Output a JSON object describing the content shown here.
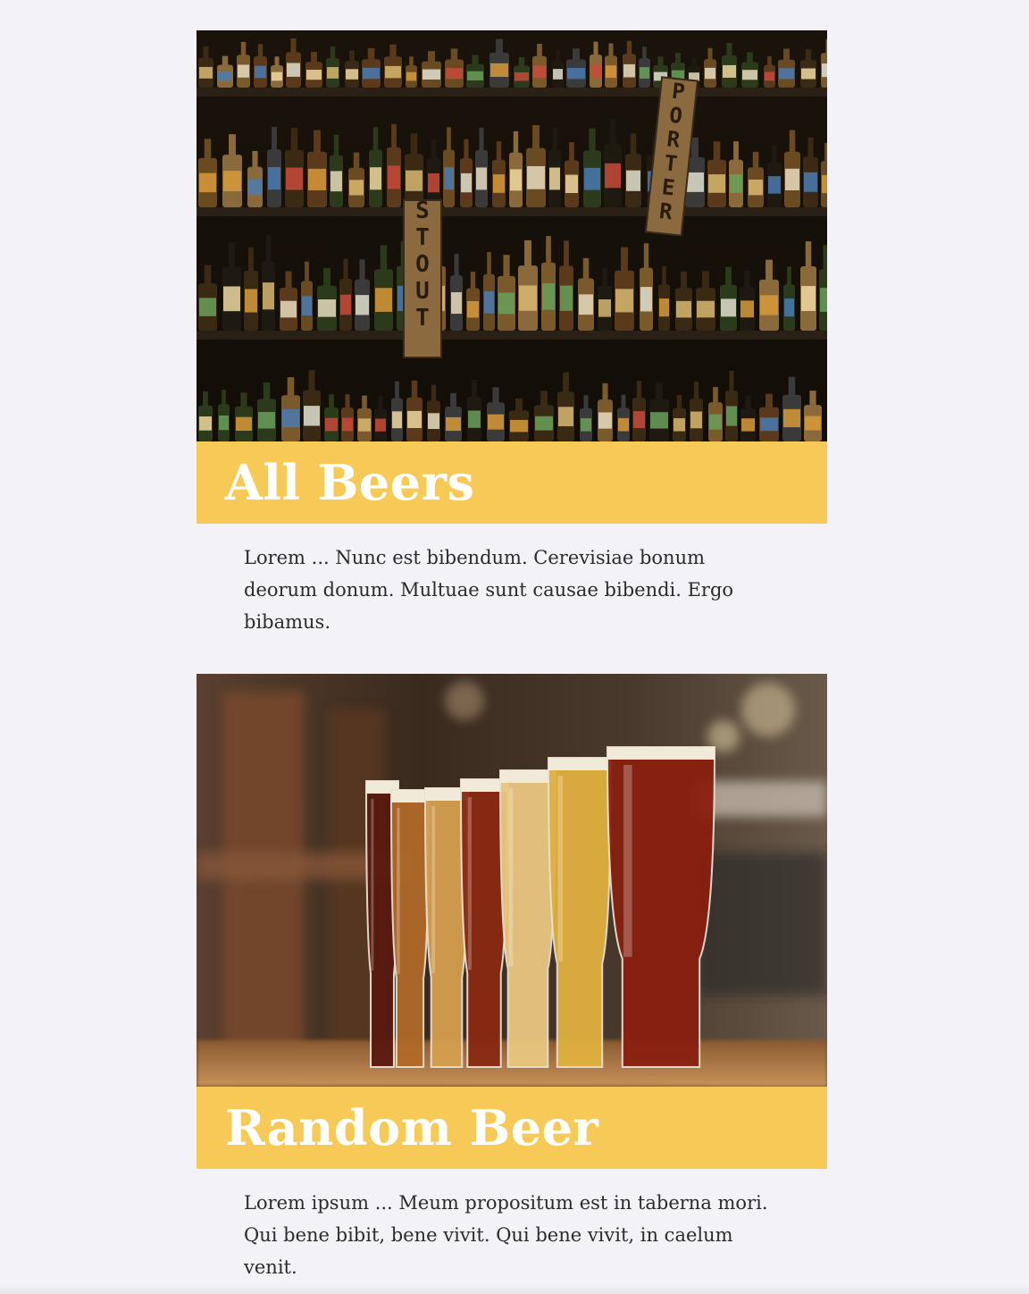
{
  "cards": [
    {
      "title": "All Beers",
      "description": "Lorem ... Nunc est bibendum. Cerevisiae bonum deorum donum. Multuae sunt causae bibendi. Ergo bibamus.",
      "image_signs": [
        "STOUT",
        "PORTER"
      ]
    },
    {
      "title": "Random Beer",
      "description": "Lorem ipsum ... Meum propositum est in taberna mori. Qui bene bibit, bene vivit. Qui bene vivit, in caelum venit."
    }
  ],
  "colors": {
    "background": "#f3f3f7",
    "banner": "#f7c957",
    "title": "#ffffff",
    "text": "#2b2b2b"
  }
}
